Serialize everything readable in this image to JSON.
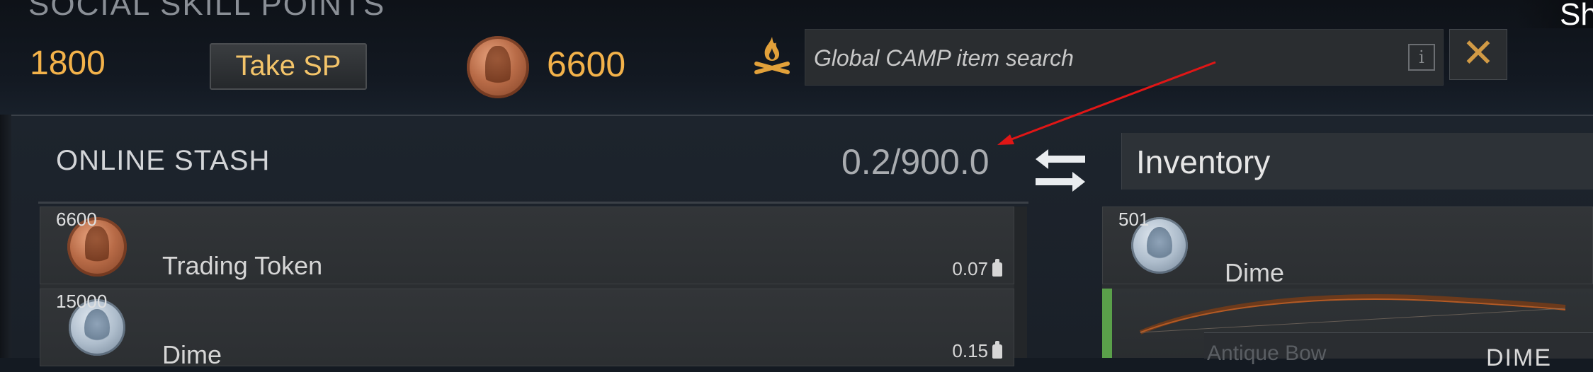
{
  "header": {
    "social_skill_points_title": "SOCIAL SKILL POINTS",
    "sp_value": "1800",
    "take_sp_label": "Take SP",
    "trading_token_amount": "6600",
    "search_placeholder": "Global CAMP item search",
    "info_glyph": "i",
    "close_glyph": "✕",
    "corner_text": "Sh"
  },
  "stash": {
    "title": "ONLINE STASH",
    "weight": "0.2/900.0",
    "items": [
      {
        "count": "6600",
        "name": "Trading Token",
        "weight": "0.07",
        "icon": "bronze-coin-icon"
      },
      {
        "count": "15000",
        "name": "Dime",
        "weight": "0.15",
        "icon": "silver-coin-icon"
      }
    ]
  },
  "inventory": {
    "selected": "Inventory",
    "items": [
      {
        "count": "501",
        "name": "Dime",
        "icon": "silver-coin-icon"
      },
      {
        "count": "",
        "name": "",
        "icon": "bow-icon",
        "highlight": "#5aa04a"
      }
    ],
    "tooltip": {
      "name": "Antique Bow",
      "title": "DIME"
    }
  },
  "colors": {
    "accent": "#f3b24a",
    "annotation_arrow": "#e01616"
  }
}
